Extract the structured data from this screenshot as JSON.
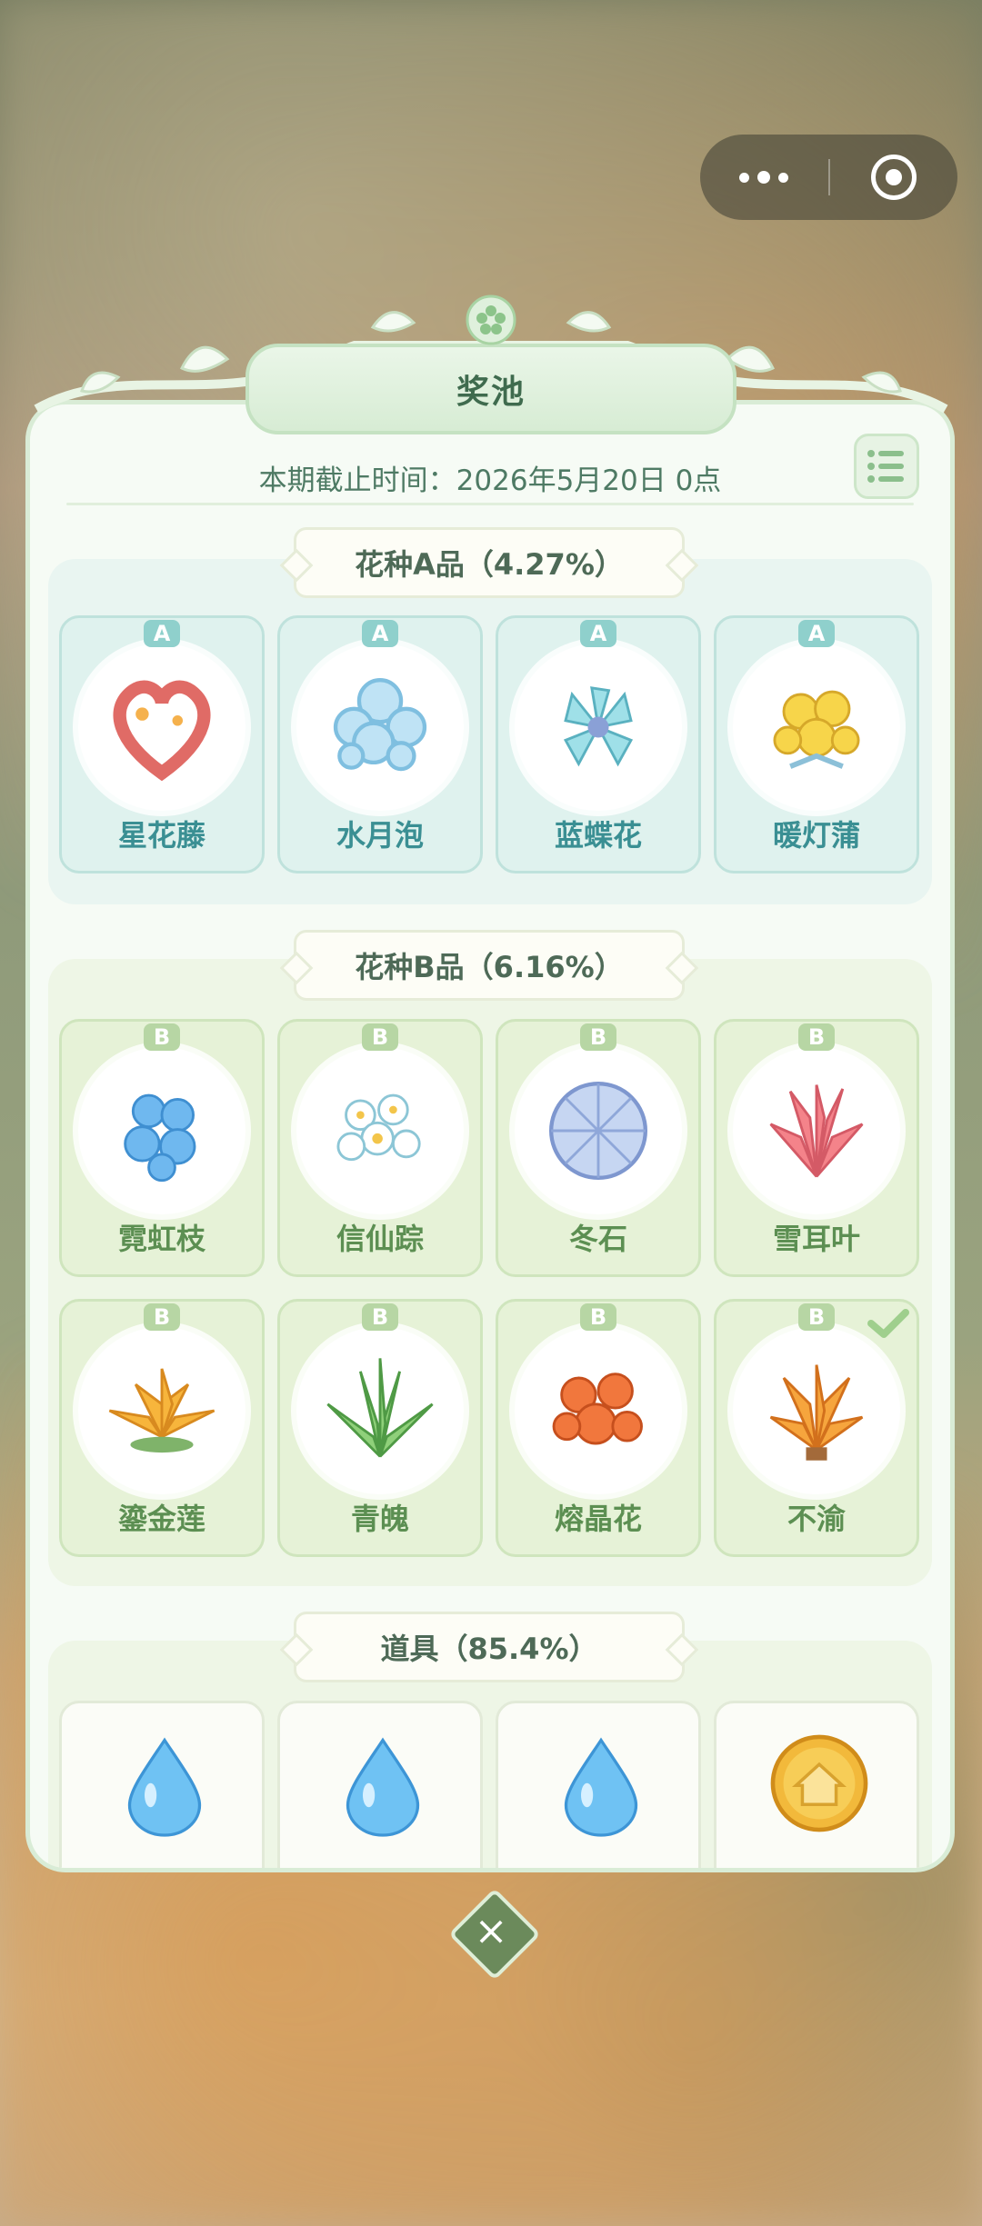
{
  "title": "奖池",
  "deadline": "本期截止时间：2026年5月20日 0点",
  "sections": {
    "a": {
      "title": "花种A品（4.27%）",
      "tier": "A",
      "items": [
        "星花藤",
        "水月泡",
        "蓝蝶花",
        "暖灯蒲"
      ]
    },
    "b": {
      "title": "花种B品（6.16%）",
      "tier": "B",
      "items": [
        "霓虹枝",
        "信仙踪",
        "冬石",
        "雪耳叶",
        "鎏金莲",
        "青魄",
        "熔晶花",
        "不渝"
      ]
    },
    "c": {
      "title": "道具（85.4%）",
      "items": [
        "water-drop-icon",
        "water-drop-icon",
        "water-drop-icon",
        "coin-house-icon"
      ]
    }
  },
  "colors": {
    "accent": "#3f6b4e",
    "tierA": "#3a8f93",
    "tierB": "#5c8f52"
  },
  "checked_item": "不渝"
}
